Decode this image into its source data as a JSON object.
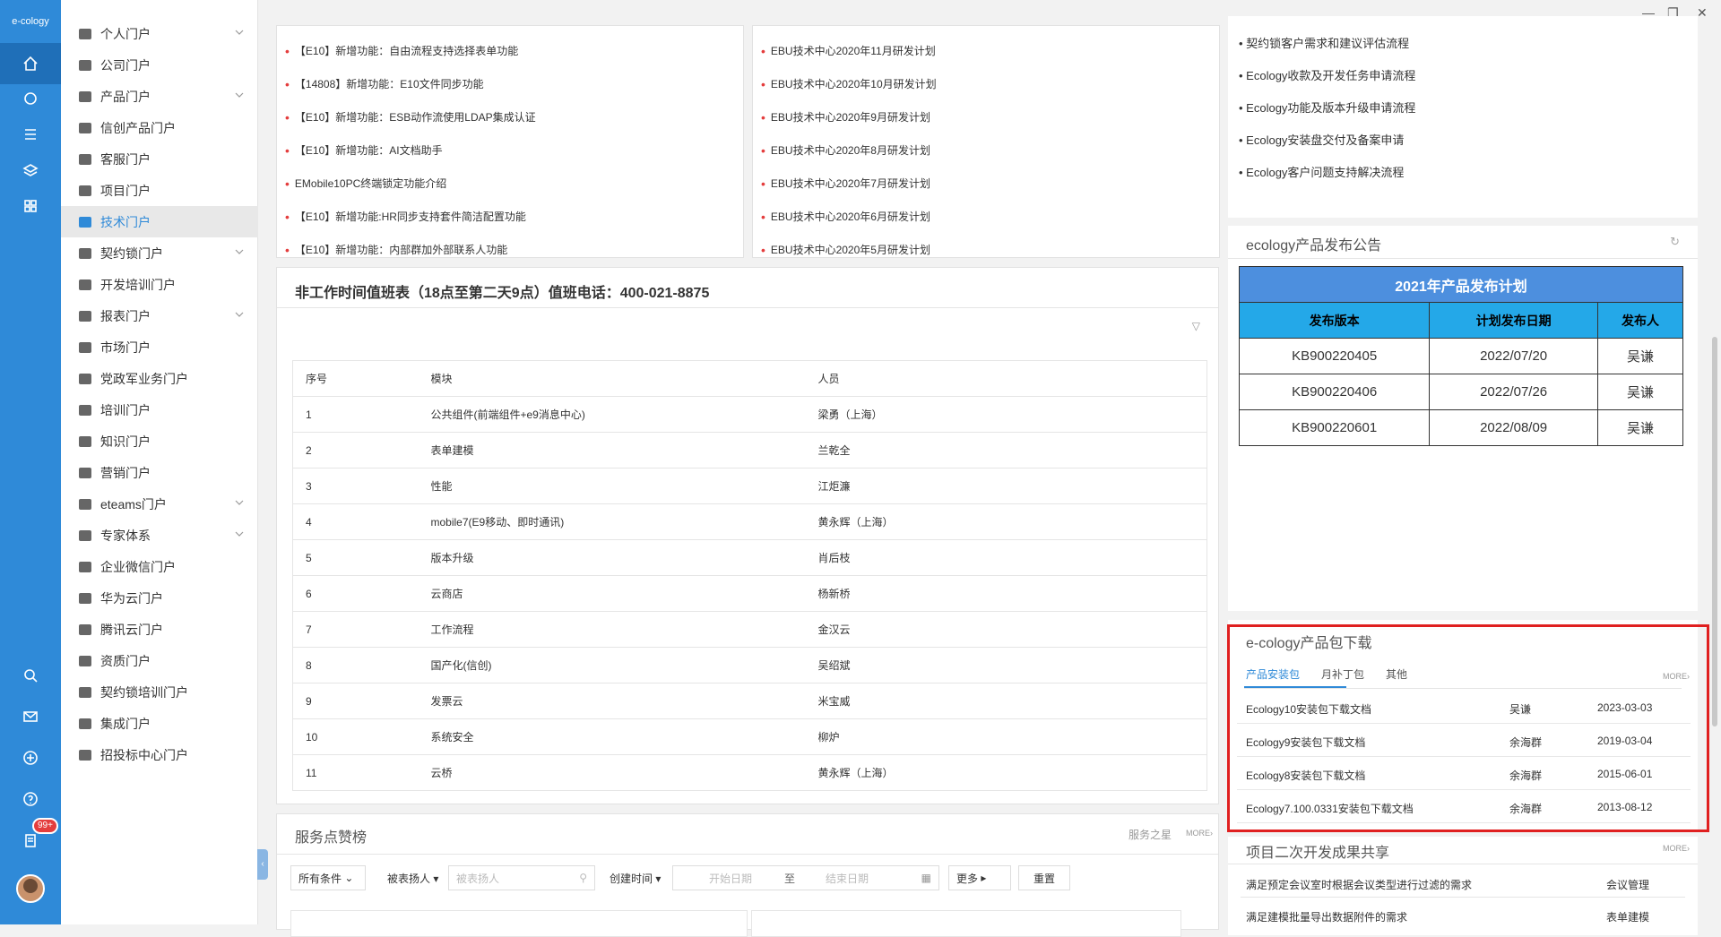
{
  "app": {
    "logo": "e-cology"
  },
  "rail": {
    "badge": "99+"
  },
  "menu": {
    "items": [
      {
        "label": "个人门户",
        "chevron": true
      },
      {
        "label": "公司门户",
        "chevron": false
      },
      {
        "label": "产品门户",
        "chevron": true
      },
      {
        "label": "信创产品门户",
        "chevron": false
      },
      {
        "label": "客服门户",
        "chevron": false
      },
      {
        "label": "项目门户",
        "chevron": false
      },
      {
        "label": "技术门户",
        "chevron": false,
        "active": true
      },
      {
        "label": "契约锁门户",
        "chevron": true
      },
      {
        "label": "开发培训门户",
        "chevron": false
      },
      {
        "label": "报表门户",
        "chevron": true
      },
      {
        "label": "市场门户",
        "chevron": false
      },
      {
        "label": "党政军业务门户",
        "chevron": false
      },
      {
        "label": "培训门户",
        "chevron": false
      },
      {
        "label": "知识门户",
        "chevron": false
      },
      {
        "label": "营销门户",
        "chevron": false
      },
      {
        "label": "eteams门户",
        "chevron": true
      },
      {
        "label": "专家体系",
        "chevron": true
      },
      {
        "label": "企业微信门户",
        "chevron": false
      },
      {
        "label": "华为云门户",
        "chevron": false
      },
      {
        "label": "腾讯云门户",
        "chevron": false
      },
      {
        "label": "资质门户",
        "chevron": false
      },
      {
        "label": "契约锁培训门户",
        "chevron": false
      },
      {
        "label": "集成门户",
        "chevron": false
      },
      {
        "label": "招投标中心门户",
        "chevron": false
      }
    ]
  },
  "news_left": [
    "【E10】新增功能：自由流程支持选择表单功能",
    "【14808】新增功能：E10文件同步功能",
    "【E10】新增功能：ESB动作流使用LDAP集成认证",
    "【E10】新增功能：AI文档助手",
    "EMobile10PC终端锁定功能介绍",
    "【E10】新增功能:HR同步支持套件简洁配置功能",
    "【E10】新增功能：内部群加外部联系人功能"
  ],
  "news_right": [
    "EBU技术中心2020年11月研发计划",
    "EBU技术中心2020年10月研发计划",
    "EBU技术中心2020年9月研发计划",
    "EBU技术中心2020年8月研发计划",
    "EBU技术中心2020年7月研发计划",
    "EBU技术中心2020年6月研发计划",
    "EBU技术中心2020年5月研发计划"
  ],
  "duty": {
    "title": "非工作时间值班表（18点至第二天9点）值班电话：400-021-8875",
    "headers": [
      "序号",
      "模块",
      "人员"
    ],
    "rows": [
      [
        "1",
        "公共组件(前端组件+e9消息中心)",
        "梁勇（上海）"
      ],
      [
        "2",
        "表单建模",
        "兰乾全"
      ],
      [
        "3",
        "性能",
        "江炬濂"
      ],
      [
        "4",
        "mobile7(E9移动、即时通讯)",
        "黄永辉（上海）"
      ],
      [
        "5",
        "版本升级",
        "肖后枝"
      ],
      [
        "6",
        "云商店",
        "杨新桥"
      ],
      [
        "7",
        "工作流程",
        "金汉云"
      ],
      [
        "8",
        "国产化(信创)",
        "吴绍斌"
      ],
      [
        "9",
        "发票云",
        "米宝威"
      ],
      [
        "10",
        "系统安全",
        "柳炉"
      ],
      [
        "11",
        "云桥",
        "黄永辉（上海）"
      ]
    ]
  },
  "processes": [
    "契约锁客户需求和建议评估流程",
    "Ecology收款及开发任务申请流程",
    "Ecology功能及版本升级申请流程",
    "Ecology安装盘交付及备案申请",
    "Ecology客户问题支持解决流程"
  ],
  "release": {
    "section_title": "ecology产品发布公告",
    "caption": "2021年产品发布计划",
    "headers": [
      "发布版本",
      "计划发布日期",
      "发布人"
    ],
    "rows": [
      [
        "KB900220405",
        "2022/07/20",
        "吴谦"
      ],
      [
        "KB900220406",
        "2022/07/26",
        "吴谦"
      ],
      [
        "KB900220601",
        "2022/08/09",
        "吴谦"
      ]
    ]
  },
  "download": {
    "title": "e-cology产品包下载",
    "tabs": [
      "产品安装包",
      "月补丁包",
      "其他"
    ],
    "more": "MORE›",
    "rows": [
      [
        "Ecology10安装包下载文档",
        "吴谦",
        "2023-03-03"
      ],
      [
        "Ecology9安装包下载文档",
        "余海群",
        "2019-03-04"
      ],
      [
        "Ecology8安装包下载文档",
        "余海群",
        "2015-06-01"
      ],
      [
        "Ecology7.100.0331安装包下载文档",
        "余海群",
        "2013-08-12"
      ]
    ]
  },
  "service": {
    "title": "服务点赞榜",
    "star": "服务之星",
    "more": "MORE›",
    "filters": {
      "all": "所有条件",
      "praised": "被表扬人",
      "praised_placeholder": "被表扬人",
      "created": "创建时间",
      "start": "开始日期",
      "to": "至",
      "end": "结束日期",
      "more": "更多",
      "reset": "重置"
    }
  },
  "share": {
    "title": "项目二次开发成果共享",
    "more": "MORE›",
    "rows": [
      [
        "满足预定会议室时根据会议类型进行过滤的需求",
        "会议管理"
      ],
      [
        "满足建模批量导出数据附件的需求",
        "表单建模"
      ]
    ]
  },
  "colors": {
    "rail": "#2f8ad8",
    "highlight": "#e02020",
    "release_caption": "#4d8fde",
    "release_header": "#24a8e8"
  }
}
